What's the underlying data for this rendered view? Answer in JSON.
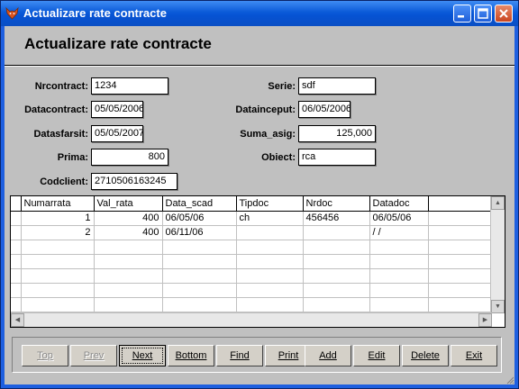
{
  "window": {
    "title": "Actualizare rate contracte"
  },
  "form": {
    "title": "Actualizare rate contracte",
    "fields": {
      "nrcontract": {
        "label": "Nrcontract:",
        "value": "1234"
      },
      "datacontract": {
        "label": "Datacontract:",
        "value": "05/05/2006"
      },
      "datasfarsit": {
        "label": "Datasfarsit:",
        "value": "05/05/2007"
      },
      "prima": {
        "label": "Prima:",
        "value": "800"
      },
      "codclient": {
        "label": "Codclient:",
        "value": "2710506163245"
      },
      "serie": {
        "label": "Serie:",
        "value": "sdf"
      },
      "datainceput": {
        "label": "Datainceput:",
        "value": "06/05/2006"
      },
      "suma_asig": {
        "label": "Suma_asig:",
        "value": "125,000"
      },
      "obiect": {
        "label": "Obiect:",
        "value": "rca"
      }
    }
  },
  "grid": {
    "columns": [
      "Numarrata",
      "Val_rata",
      "Data_scad",
      "Tipdoc",
      "Nrdoc",
      "Datadoc"
    ],
    "rows": [
      [
        "1",
        "400",
        "06/05/06",
        "ch",
        "456456",
        "06/05/06"
      ],
      [
        "2",
        "400",
        "06/11/06",
        "",
        "",
        "/ /"
      ]
    ]
  },
  "buttons": {
    "top": "Top",
    "prev": "Prev",
    "next": "Next",
    "bottom": "Bottom",
    "find": "Find",
    "print": "Print",
    "add": "Add",
    "edit": "Edit",
    "delete": "Delete",
    "exit": "Exit"
  },
  "colors": {
    "titlebar": "#0a5ad8",
    "client": "#c0c0c0"
  },
  "icons": [
    "fox-app-icon",
    "minimize-icon",
    "maximize-icon",
    "close-icon"
  ]
}
